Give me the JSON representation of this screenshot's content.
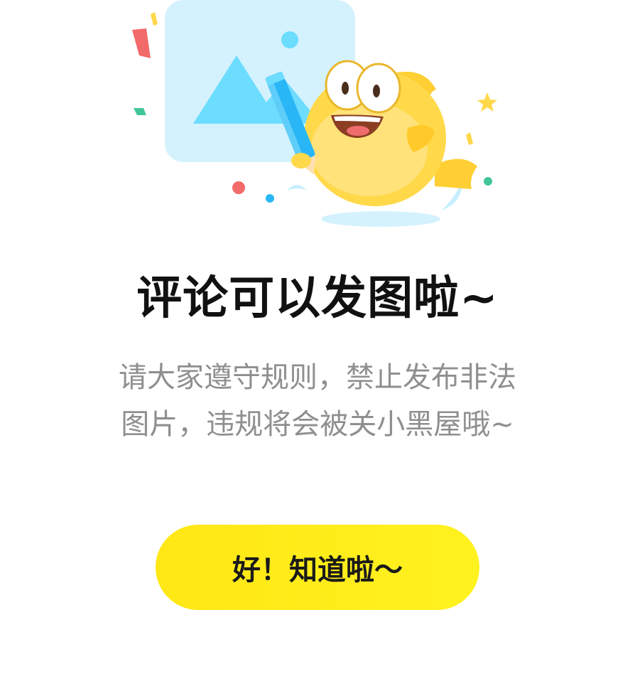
{
  "dialog": {
    "title": "评论可以发图啦~",
    "description_line1": "请大家遵守规则，禁止发布非法",
    "description_line2": "图片，违规将会被关小黑屋哦~",
    "confirm_label": "好！知道啦～"
  },
  "illustration": {
    "icon": "image-placeholder-icon",
    "mascot": "yellow-fish-mascot-with-pencil"
  },
  "colors": {
    "button": "#FFEB16",
    "title": "#111111",
    "description": "#8F8F8F",
    "card": "#FFFFFF",
    "image_tile": "#D4F2FE",
    "image_shapes": "#6CDCFF",
    "mascot": "#FFD94A"
  }
}
